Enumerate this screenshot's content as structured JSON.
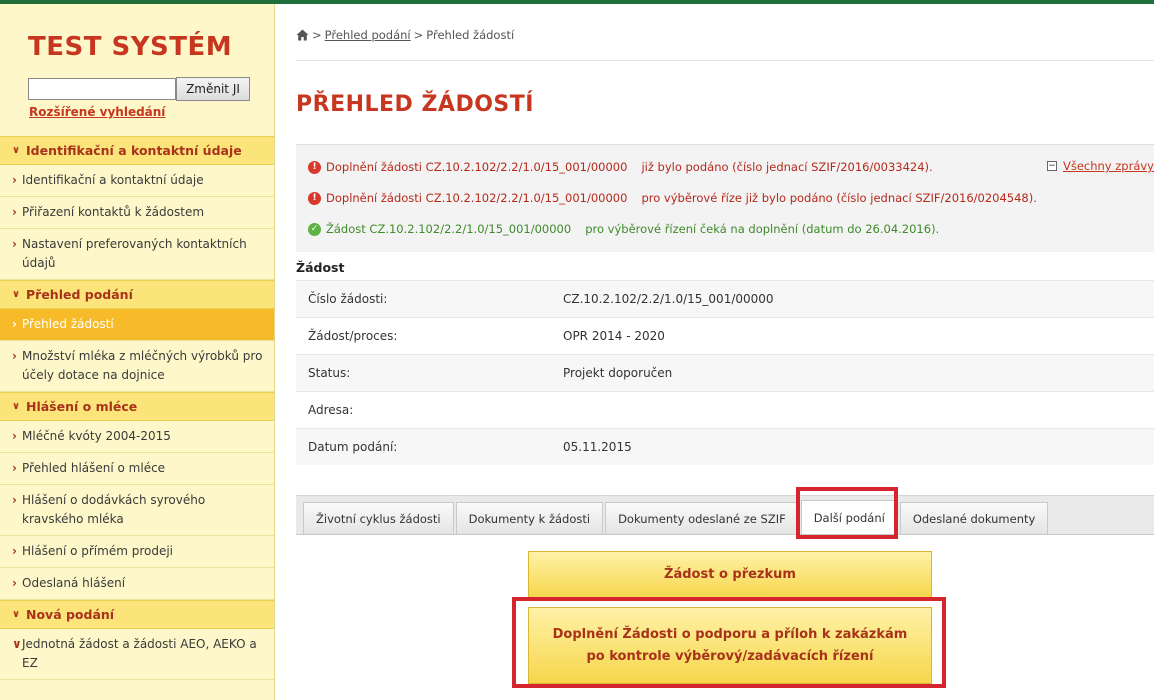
{
  "sidebar": {
    "system_title": "TEST SYSTÉM",
    "search": {
      "value": "",
      "button_label": "Změnit JI"
    },
    "advanced_search_label": "Rozšířené vyhledání",
    "sections": [
      {
        "label": "Identifikační a kontaktní údaje",
        "items": [
          "Identifikační a kontaktní údaje",
          "Přiřazení kontaktů k žádostem",
          "Nastavení preferovaných kontaktních údajů"
        ]
      },
      {
        "label": "Přehled podání",
        "items": [
          "Přehled žádostí",
          "Množství mléka z mléčných výrobků pro účely dotace na dojnice"
        ],
        "active_item": "Přehled žádostí"
      },
      {
        "label": "Hlášení o mléce",
        "items": [
          "Mléčné kvóty 2004-2015",
          "Přehled hlášení o mléce",
          "Hlášení o dodávkách syrového kravského mléka",
          "Hlášení o přímém prodeji",
          "Odeslaná hlášení"
        ]
      },
      {
        "label": "Nová podání",
        "items": [
          "Jednotná žádost a žádosti AEO, AEKO a EZ"
        ]
      }
    ]
  },
  "breadcrumb": {
    "sep": ">",
    "link": "Přehled podání",
    "current": "Přehled žádostí"
  },
  "page_title": "PŘEHLED ŽÁDOSTÍ",
  "messages": [
    {
      "type": "error",
      "part1": "Doplnění žádosti CZ.10.2.102/2.2/1.0/15_001/00000",
      "part2": "již bylo podáno (číslo jednací SZIF/2016/0033424)."
    },
    {
      "type": "error",
      "part1": "Doplnění žádosti CZ.10.2.102/2.2/1.0/15_001/00000",
      "part2": "pro výběrové říze již bylo podáno (číslo jednací SZIF/2016/0204548)."
    },
    {
      "type": "ok",
      "part1": "Žádost CZ.10.2.102/2.2/1.0/15_001/00000",
      "part2": "pro výběrové řízení čeká na doplnění (datum do 26.04.2016)."
    }
  ],
  "all_messages": {
    "toggle": "−",
    "label": "Všechny zprávy"
  },
  "details": {
    "heading": "Žádost",
    "rows": [
      {
        "key": "Číslo žádosti:",
        "value": "CZ.10.2.102/2.2/1.0/15_001/00000"
      },
      {
        "key": "Žádost/proces:",
        "value": "OPR 2014 - 2020"
      },
      {
        "key": "Status:",
        "value": "Projekt doporučen"
      },
      {
        "key": "Adresa:",
        "value": ""
      },
      {
        "key": "Datum podání:",
        "value": "05.11.2015"
      }
    ]
  },
  "tabs": [
    "Životní cyklus žádosti",
    "Dokumenty k žádosti",
    "Dokumenty odeslané ze SZIF",
    "Další podání",
    "Odeslané dokumenty"
  ],
  "active_tab": "Další podání",
  "actions": {
    "review_label": "Žádost o přezkum",
    "supplement_line1": "Doplnění Žádosti o podporu a příloh k zakázkám",
    "supplement_line2": "po kontrole výběrový/zadávacích řízení"
  },
  "colors": {
    "brand_red": "#c7361e",
    "sidebar_bg": "#fdf7c9",
    "active_menu": "#f7bb2a",
    "highlight": "#d5262f"
  }
}
